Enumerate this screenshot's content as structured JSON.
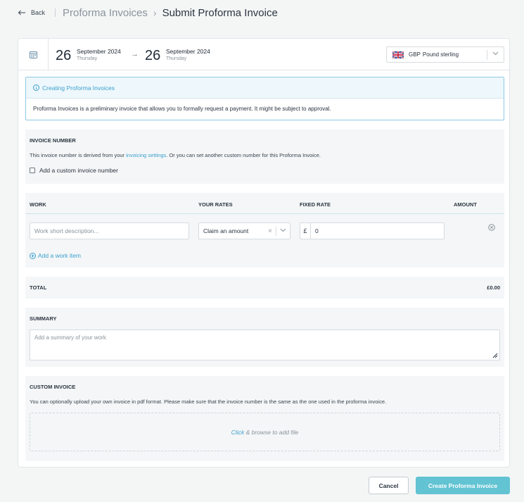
{
  "header": {
    "back_label": "Back",
    "breadcrumb_parent": "Proforma Invoices",
    "breadcrumb_current": "Submit Proforma Invoice"
  },
  "dates": {
    "start": {
      "day": "26",
      "month_year": "September 2024",
      "weekday": "Thursday"
    },
    "end": {
      "day": "26",
      "month_year": "September 2024",
      "weekday": "Thursday"
    },
    "arrow": "→"
  },
  "currency": {
    "code": "GBP",
    "name": "Pound sterling",
    "flag_icon": "uk-flag-icon"
  },
  "info": {
    "title": "Creating Proforma Invoices",
    "text": "Proforma Invoices is a preliminary invoice that allows you to formally request a payment. It might be subject to approval."
  },
  "invoice_number": {
    "title": "INVOICE NUMBER",
    "text_before": "This invoice number is derived from your ",
    "link": "invoicing settings",
    "text_after": ". Or you can set another custom number for this Proforma Invoice.",
    "checkbox_label": "Add a custom invoice number",
    "checkbox_checked": false
  },
  "work": {
    "columns": [
      "WORK",
      "YOUR RATES",
      "FIXED RATE",
      "AMOUNT"
    ],
    "description_placeholder": "Work short description...",
    "rate_selected": "Claim an amount",
    "currency_symbol": "£",
    "fixed_rate_value": "0",
    "add_item_label": "Add a work item"
  },
  "total": {
    "label": "TOTAL",
    "value": "£0.00"
  },
  "summary": {
    "title": "SUMMARY",
    "placeholder": "Add a summary of your work"
  },
  "custom_invoice": {
    "title": "CUSTOM INVOICE",
    "text": "You can optionally upload your own invoice in pdf format. Please make sure that the invoice number is the same as the one used in the proforma invoice.",
    "drop_click": "Click",
    "drop_rest": " & browse to add file"
  },
  "actions": {
    "cancel": "Cancel",
    "create": "Create Proforma Invoice"
  },
  "colors": {
    "accent": "#3aa0cf",
    "primary_button": "#62c3d2",
    "info_border": "#8fc8e3"
  }
}
